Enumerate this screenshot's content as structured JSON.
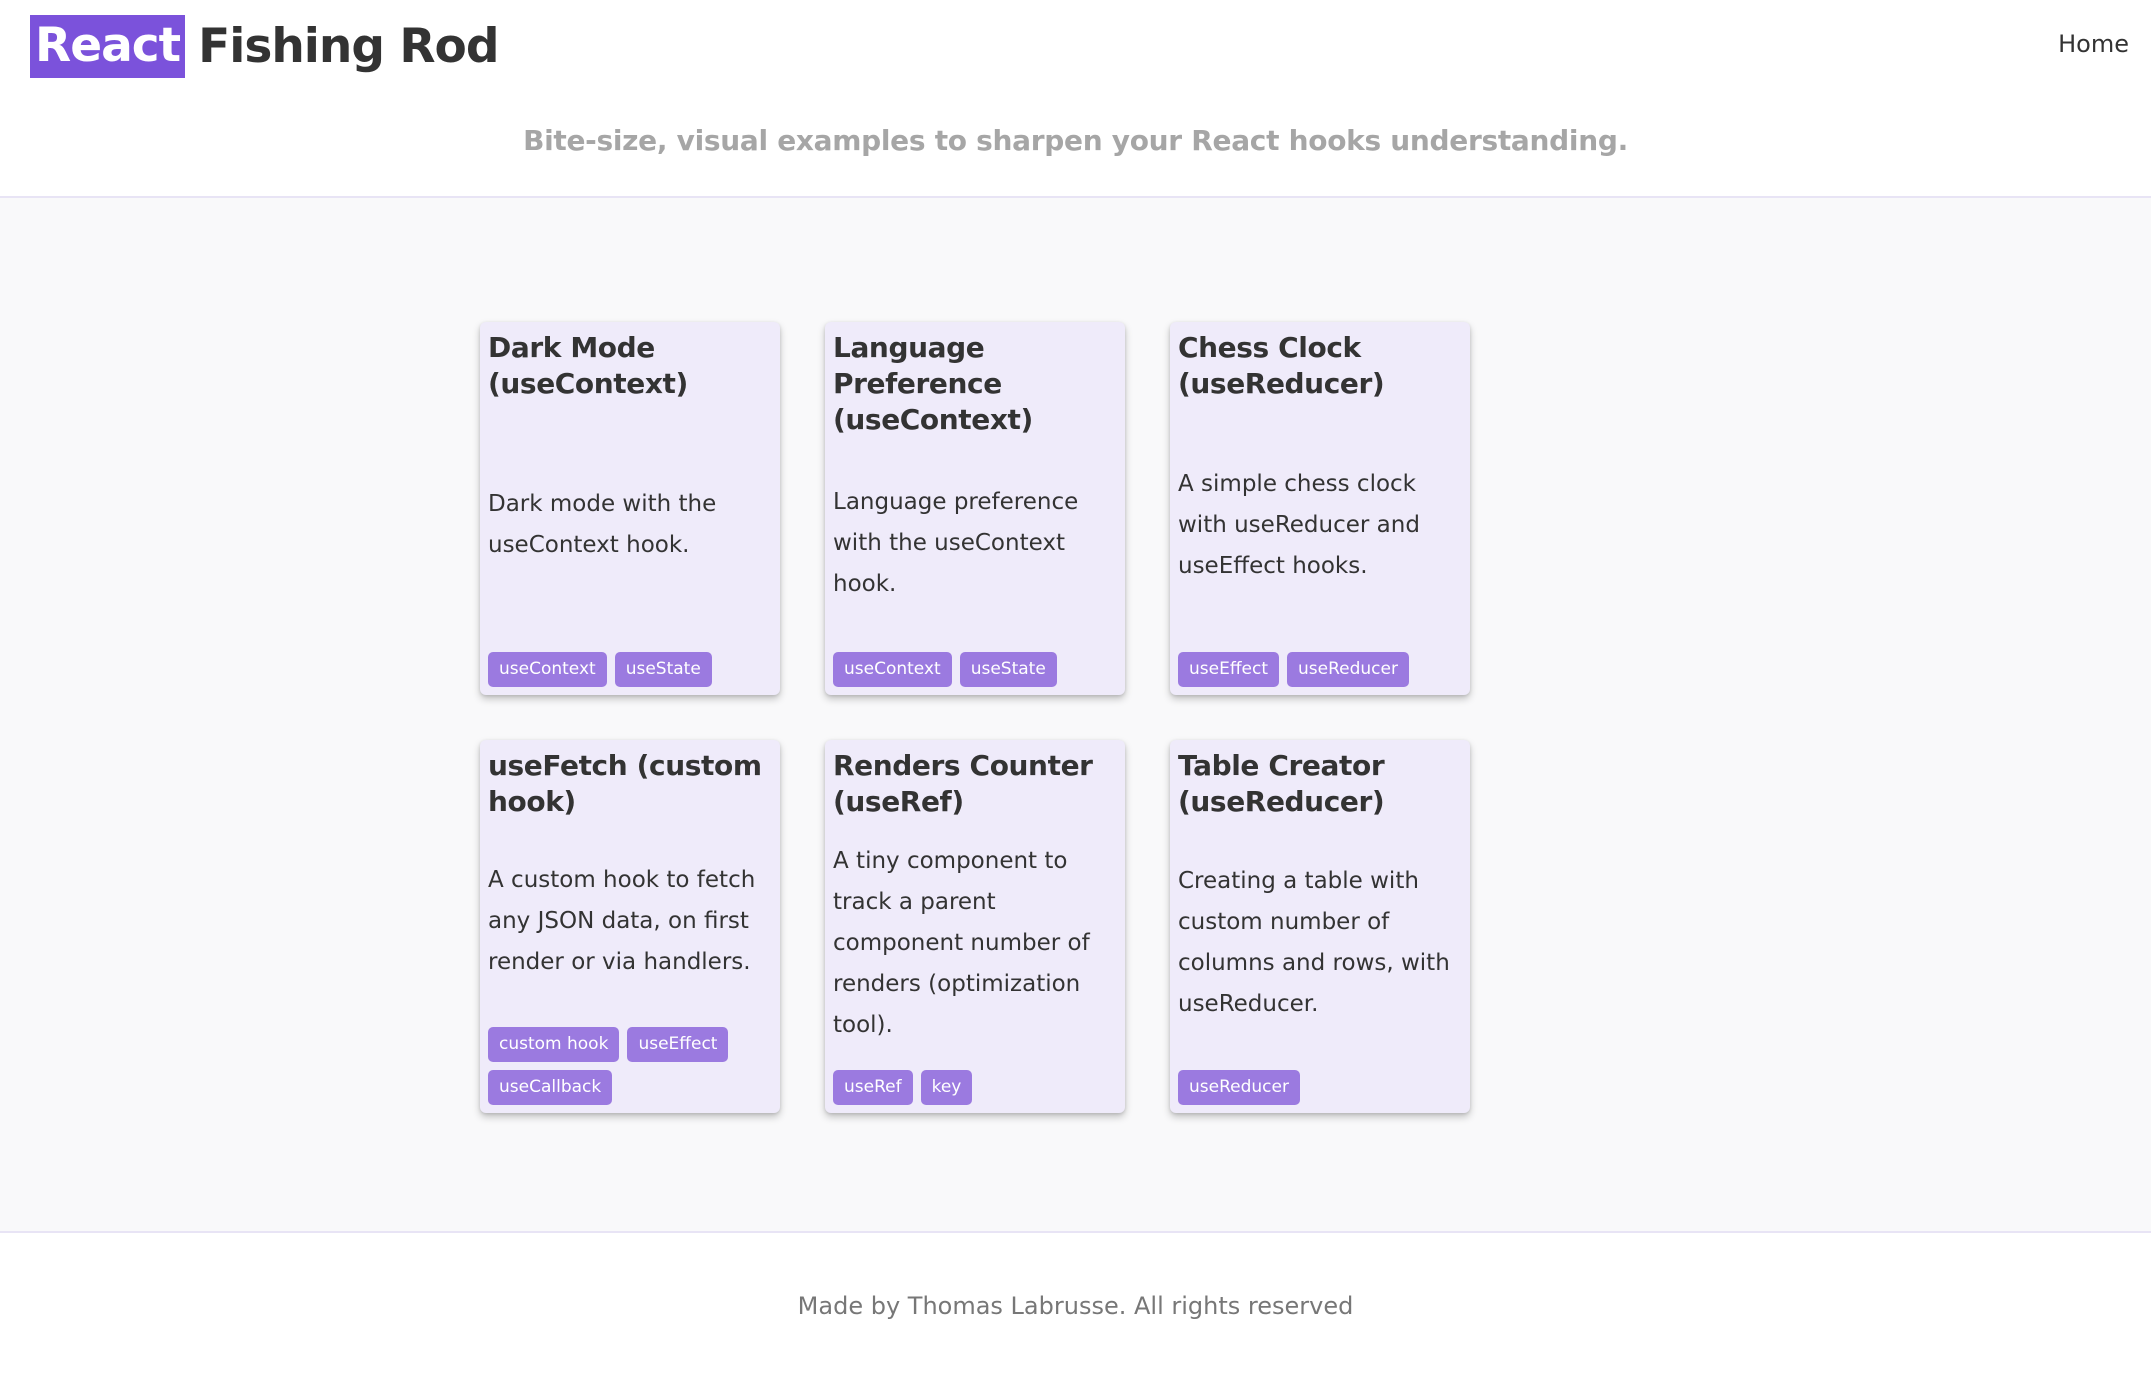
{
  "header": {
    "logo_highlight": "React",
    "logo_rest": "Fishing Rod",
    "nav_home": "Home",
    "tagline": "Bite-size, visual examples to sharpen your React hooks understanding."
  },
  "cards": [
    {
      "title": "Dark Mode (useContext)",
      "description": "Dark mode with the useContext hook.",
      "tags": [
        "useContext",
        "useState"
      ]
    },
    {
      "title": "Language Preference (useContext)",
      "description": "Language preference with the useContext hook.",
      "tags": [
        "useContext",
        "useState"
      ]
    },
    {
      "title": "Chess Clock (useReducer)",
      "description": "A simple chess clock with useReducer and useEffect hooks.",
      "tags": [
        "useEffect",
        "useReducer"
      ]
    },
    {
      "title": "useFetch (custom hook)",
      "description": "A custom hook to fetch any JSON data, on first render or via handlers.",
      "tags": [
        "custom hook",
        "useEffect",
        "useCallback"
      ]
    },
    {
      "title": "Renders Counter (useRef)",
      "description": "A tiny component to track a parent component number of renders (optimization tool).",
      "tags": [
        "useRef",
        "key"
      ]
    },
    {
      "title": "Table Creator (useReducer)",
      "description": "Creating a table with custom number of columns and rows, with useReducer.",
      "tags": [
        "useReducer"
      ]
    }
  ],
  "footer": {
    "text": "Made by Thomas Labrusse. All rights reserved"
  },
  "colors": {
    "accent": "#7b52db",
    "tag_bg": "#9b7ae0",
    "card_bg": "#efebfa",
    "main_bg": "#f9f9fa"
  }
}
